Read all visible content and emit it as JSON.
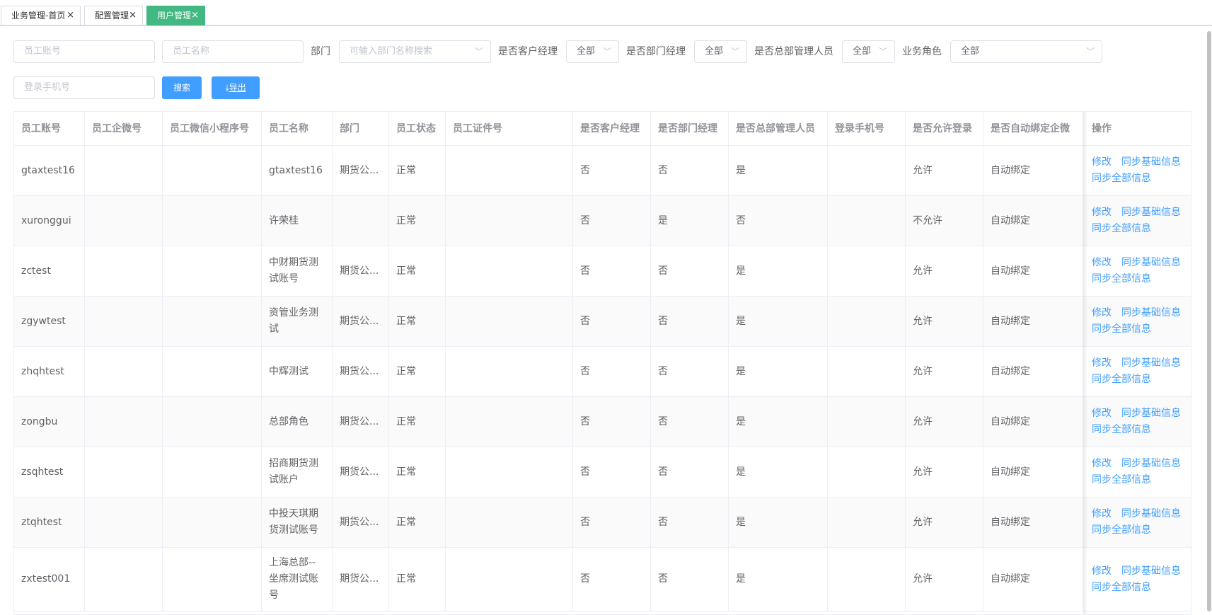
{
  "tabs": [
    {
      "label": "业务管理-首页",
      "active": false
    },
    {
      "label": "配置管理",
      "active": false
    },
    {
      "label": "用户管理",
      "active": true
    }
  ],
  "filters": {
    "account_placeholder": "员工账号",
    "name_placeholder": "员工名称",
    "dept_label": "部门",
    "dept_placeholder": "可输入部门名称搜索",
    "cust_mgr_label": "是否客户经理",
    "cust_mgr_value": "全部",
    "dept_mgr_label": "是否部门经理",
    "dept_mgr_value": "全部",
    "hq_mgr_label": "是否总部管理人员",
    "hq_mgr_value": "全部",
    "biz_role_label": "业务角色",
    "biz_role_value": "全部",
    "phone_placeholder": "登录手机号",
    "search_label": "搜索",
    "export_label": "导出"
  },
  "table": {
    "columns": [
      "员工账号",
      "员工企微号",
      "员工微信小程序号",
      "员工名称",
      "部门",
      "员工状态",
      "员工证件号",
      "是否客户经理",
      "是否部门经理",
      "是否总部管理人员",
      "登录手机号",
      "是否允许登录",
      "是否自动绑定企微",
      "操作"
    ],
    "rows": [
      [
        "gtaxtest16",
        "",
        "",
        "gtaxtest16",
        "期货公...",
        "正常",
        "",
        "否",
        "否",
        "是",
        "",
        "允许",
        "自动绑定"
      ],
      [
        "xuronggui",
        "",
        "",
        "许荣桂",
        "",
        "正常",
        "",
        "否",
        "是",
        "否",
        "",
        "不允许",
        "自动绑定"
      ],
      [
        "zctest",
        "",
        "",
        "中财期货测试账号",
        "期货公...",
        "正常",
        "",
        "否",
        "否",
        "是",
        "",
        "允许",
        "自动绑定"
      ],
      [
        "zgywtest",
        "",
        "",
        "资管业务测试",
        "期货公...",
        "正常",
        "",
        "否",
        "否",
        "是",
        "",
        "允许",
        "自动绑定"
      ],
      [
        "zhqhtest",
        "",
        "",
        "中辉测试",
        "期货公...",
        "正常",
        "",
        "否",
        "否",
        "是",
        "",
        "允许",
        "自动绑定"
      ],
      [
        "zongbu",
        "",
        "",
        "总部角色",
        "期货公...",
        "正常",
        "",
        "否",
        "否",
        "是",
        "",
        "允许",
        "自动绑定"
      ],
      [
        "zsqhtest",
        "",
        "",
        "招商期货测试账户",
        "期货公...",
        "正常",
        "",
        "否",
        "否",
        "是",
        "",
        "允许",
        "自动绑定"
      ],
      [
        "ztqhtest",
        "",
        "",
        "中投天琪期货测试账号",
        "期货公...",
        "正常",
        "",
        "否",
        "否",
        "是",
        "",
        "允许",
        "自动绑定"
      ],
      [
        "zxtest001",
        "",
        "",
        "上海总部--坐席测试账号",
        "期货公...",
        "正常",
        "",
        "否",
        "否",
        "是",
        "",
        "允许",
        "自动绑定"
      ]
    ],
    "actions": {
      "edit": "修改",
      "sync_basic": "同步基础信息",
      "sync_all": "同步全部信息"
    }
  },
  "colors": {
    "accent": "#409eff",
    "active_tab": "#42b983"
  }
}
